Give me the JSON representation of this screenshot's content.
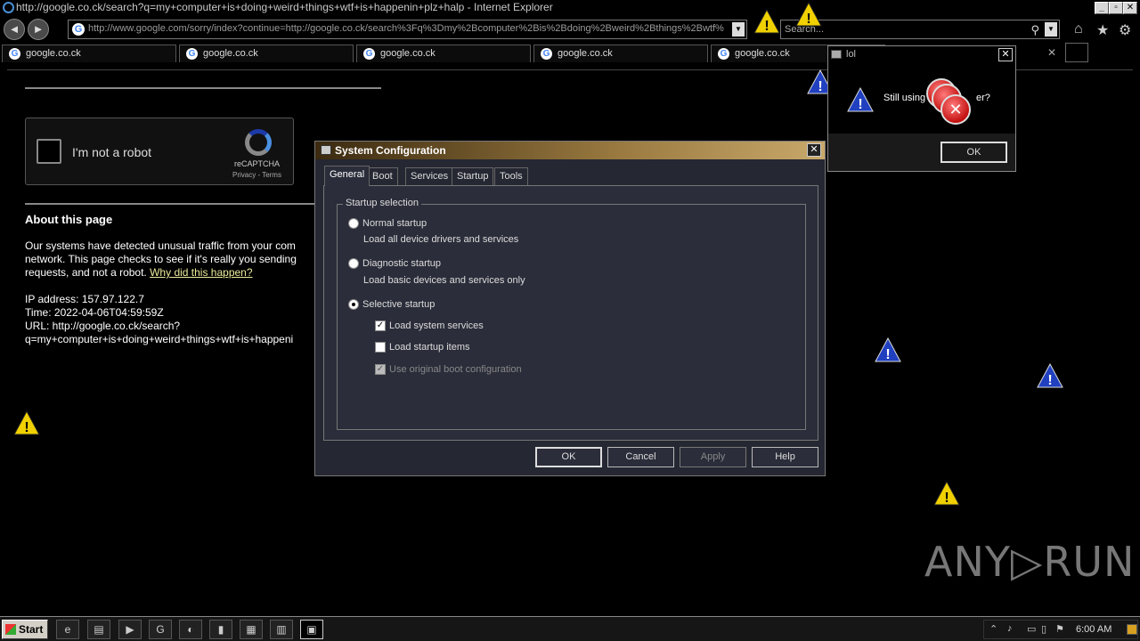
{
  "window": {
    "title": "http://google.co.ck/search?q=my+computer+is+doing+weird+things+wtf+is+happenin+plz+halp - Internet Explorer",
    "minimize": "_",
    "maximize": "▫",
    "close": "✕"
  },
  "navbar": {
    "back": "◄",
    "forward": "►",
    "address_url": "http://www.google.com/sorry/index?continue=http://google.co.ck/search%3Fq%3Dmy%2Bcomputer%2Bis%2Bdoing%2Bweird%2Bthings%2Bwtf%",
    "address_dropdown": "▼",
    "search_placeholder": "Search...",
    "search_icon": "⚲",
    "home": "⌂",
    "favorites": "★",
    "tools": "⚙"
  },
  "tabs": [
    {
      "label": "google.co.ck"
    },
    {
      "label": "google.co.ck"
    },
    {
      "label": "google.co.ck"
    },
    {
      "label": "google.co.ck"
    },
    {
      "label": "google.co.ck"
    }
  ],
  "tab_close": "✕",
  "page": {
    "recaptcha": {
      "label": "I'm not a robot",
      "brand": "reCAPTCHA",
      "links": "Privacy - Terms"
    },
    "about_heading": "About this page",
    "para_line1": "Our systems have detected unusual traffic from your com",
    "para_line2": "network. This page checks to see if it's really you sending",
    "para_line3_prefix": "requests, and not a robot.",
    "para_link": "Why did this happen?",
    "ip": "IP address: 157.97.122.7",
    "time": "Time: 2022-04-06T04:59:59Z",
    "url_line1": "URL: http://google.co.ck/search?",
    "url_line2": "q=my+computer+is+doing+weird+things+wtf+is+happeni"
  },
  "syscfg": {
    "title": "System Configuration",
    "close": "✕",
    "tabs": [
      "General",
      "Boot",
      "Services",
      "Startup",
      "Tools"
    ],
    "group_label": "Startup selection",
    "normal_startup": "Normal startup",
    "normal_desc": "Load all device drivers and services",
    "diagnostic_startup": "Diagnostic startup",
    "diagnostic_desc": "Load basic devices and services only",
    "selective_startup": "Selective startup",
    "load_system_services": "Load system services",
    "load_startup_items": "Load startup items",
    "use_original_boot": "Use original boot configuration",
    "check_mark": "✓",
    "buttons": {
      "ok": "OK",
      "cancel": "Cancel",
      "apply": "Apply",
      "help": "Help"
    }
  },
  "lol_dialog": {
    "title": "lol",
    "close": "✕",
    "message_start": "Still using",
    "message_end": "er?",
    "error_glyph": "✕",
    "ok": "OK"
  },
  "taskbar": {
    "start": "Start",
    "clock": "6:00 AM",
    "buttons": [
      "e",
      "▤",
      "▶",
      "G",
      "◐",
      "▮",
      "▦",
      "▥",
      "▣"
    ],
    "tray": [
      "⌃",
      "♪",
      "▭",
      "▯",
      "⚑"
    ]
  },
  "watermark": "ANY▷RUN",
  "colors": {
    "warning": "#f0d000",
    "info_blue": "#2040c0",
    "error_red": "#c41010"
  }
}
